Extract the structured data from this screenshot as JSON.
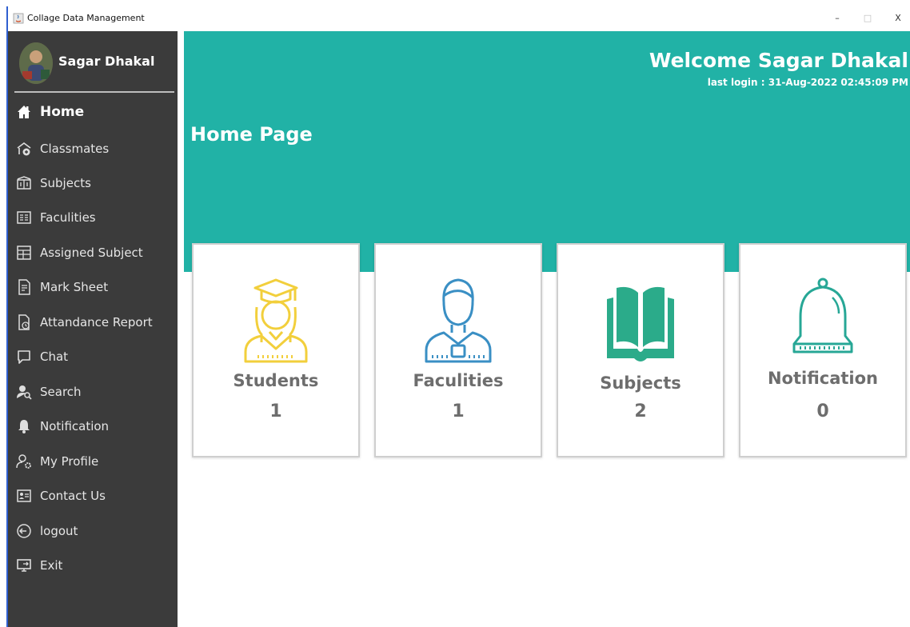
{
  "window": {
    "title": "Collage Data Management",
    "minimize": "–",
    "maximize": "□",
    "close": "X"
  },
  "profile": {
    "name": "Sagar Dhakal"
  },
  "sidebar": {
    "items": [
      {
        "label": "Home",
        "icon": "home-icon"
      },
      {
        "label": "Classmates",
        "icon": "classmates-icon"
      },
      {
        "label": "Subjects",
        "icon": "subjects-icon"
      },
      {
        "label": "Faculities",
        "icon": "faculities-icon"
      },
      {
        "label": "Assigned Subject",
        "icon": "assigned-subject-icon"
      },
      {
        "label": "Mark Sheet",
        "icon": "mark-sheet-icon"
      },
      {
        "label": "Attandance Report",
        "icon": "attendance-report-icon"
      },
      {
        "label": "Chat",
        "icon": "chat-icon"
      },
      {
        "label": "Search",
        "icon": "search-user-icon"
      },
      {
        "label": "Notification",
        "icon": "bell-icon"
      },
      {
        "label": "My Profile",
        "icon": "profile-settings-icon"
      },
      {
        "label": "Contact Us",
        "icon": "contact-card-icon"
      },
      {
        "label": "logout",
        "icon": "logout-icon"
      },
      {
        "label": "Exit",
        "icon": "exit-icon"
      }
    ]
  },
  "header": {
    "welcome": "Welcome Sagar Dhakal",
    "last_login": "last login : 31-Aug-2022 02:45:09 PM",
    "page_title": "Home Page"
  },
  "cards": [
    {
      "title": "Students",
      "count": "1",
      "icon": "student-graduate-icon",
      "color": "#f2cf3c"
    },
    {
      "title": "Faculities",
      "count": "1",
      "icon": "faculty-person-icon",
      "color": "#3a8fc4"
    },
    {
      "title": "Subjects",
      "count": "2",
      "icon": "open-book-icon",
      "color": "#2bab8a"
    },
    {
      "title": "Notification",
      "count": "0",
      "icon": "notification-bell-icon",
      "color": "#27a796"
    }
  ],
  "colors": {
    "sidebar_bg": "#3b3b3b",
    "banner_bg": "#21b2a6",
    "card_text": "#6d6d6d"
  }
}
